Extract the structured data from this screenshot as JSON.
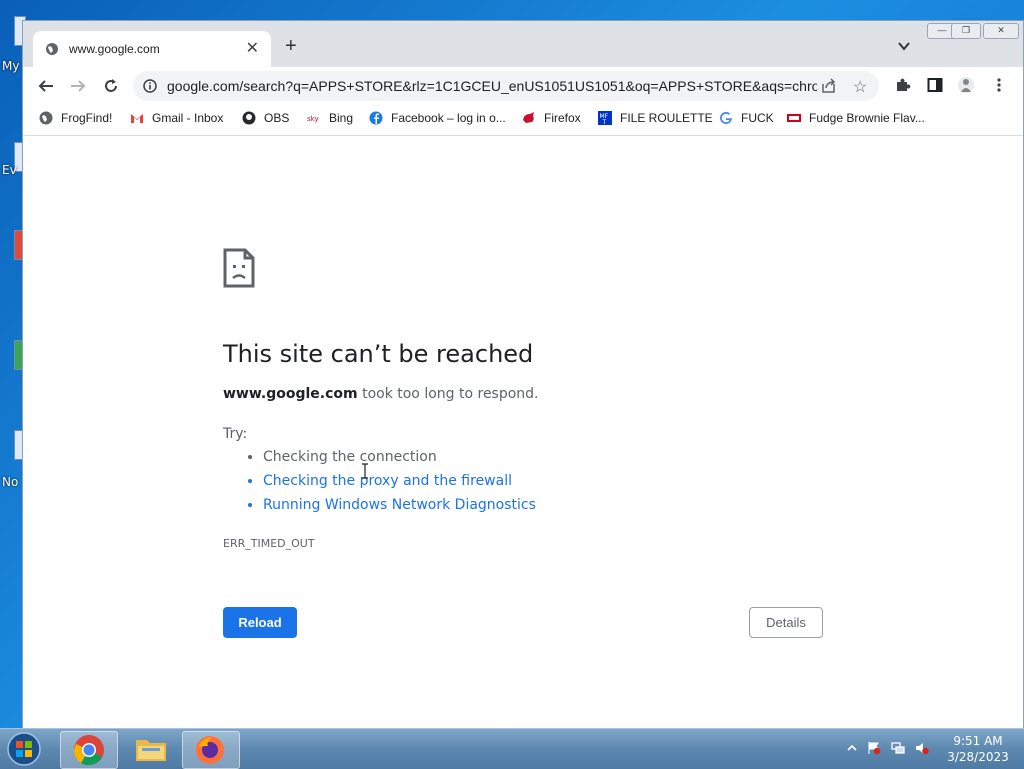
{
  "desktop": {
    "icon_labels": [
      "My",
      "Ev",
      "No"
    ]
  },
  "browser": {
    "tab": {
      "title": "www.google.com",
      "close": "✕"
    },
    "new_tab": "+",
    "window_controls": {
      "minimize": "—",
      "restore": "❐",
      "close": "✕"
    },
    "omnibox": {
      "url": "google.com/search?q=APPS+STORE&rlz=1C1GCEU_enUS1051US1051&oq=APPS+STORE&aqs=chrom..."
    },
    "bookmarks": [
      {
        "label": "FrogFind!",
        "icon": "globe-icon"
      },
      {
        "label": "Gmail - Inbox",
        "icon": "gmail-icon"
      },
      {
        "label": "OBS",
        "icon": "github-icon"
      },
      {
        "label": "Bing",
        "icon": "sky-icon"
      },
      {
        "label": "Facebook – log in o...",
        "icon": "facebook-icon"
      },
      {
        "label": "Firefox",
        "icon": "red-animal-icon"
      },
      {
        "label": "FILE ROULETTE",
        "icon": "mf-icon"
      },
      {
        "label": "FUCK",
        "icon": "google-icon"
      },
      {
        "label": "Fudge Brownie Flav...",
        "icon": "red-icon"
      }
    ]
  },
  "error_page": {
    "heading": "This site can’t be reached",
    "host": "www.google.com",
    "message": " took too long to respond.",
    "try_label": "Try:",
    "suggestions": [
      "Checking the connection",
      "Checking the proxy and the firewall",
      "Running Windows Network Diagnostics"
    ],
    "error_code": "ERR_TIMED_OUT",
    "reload_label": "Reload",
    "details_label": "Details"
  },
  "taskbar": {
    "apps": [
      "chrome",
      "file-explorer",
      "firefox"
    ],
    "clock_time": "9:51 AM",
    "clock_date": "3/28/2023"
  },
  "colors": {
    "link": "#1a73e8",
    "reload_button": "#1a73e8",
    "tab_strip": "#dee1e6"
  }
}
